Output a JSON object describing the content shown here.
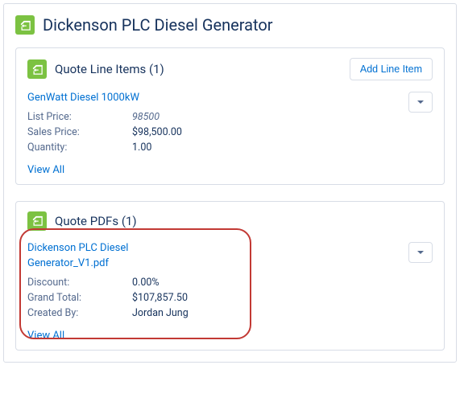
{
  "header": {
    "title": "Dickenson PLC Diesel Generator"
  },
  "lineItemsCard": {
    "titlePrefix": "Quote Line Items",
    "count": "(1)",
    "addBtn": "Add Line Item",
    "item": {
      "name": "GenWatt Diesel 1000kW",
      "listPriceLabel": "List Price:",
      "listPriceValue": "98500",
      "salesPriceLabel": "Sales Price:",
      "salesPriceValue": "$98,500.00",
      "quantityLabel": "Quantity:",
      "quantityValue": "1.00"
    },
    "viewAll": "View All"
  },
  "pdfCard": {
    "titlePrefix": "Quote PDFs",
    "count": "(1)",
    "item": {
      "name": "Dickenson PLC Diesel Generator_V1.pdf",
      "discountLabel": "Discount:",
      "discountValue": "0.00%",
      "grandTotalLabel": "Grand Total:",
      "grandTotalValue": "$107,857.50",
      "createdByLabel": "Created By:",
      "createdByValue": "Jordan Jung"
    },
    "viewAll": "View All"
  }
}
